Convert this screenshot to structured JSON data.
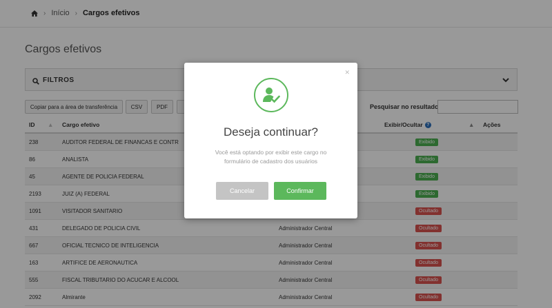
{
  "breadcrumb": {
    "home_icon": "home-icon",
    "items": [
      "Início",
      "Cargos efetivos"
    ]
  },
  "page": {
    "title": "Cargos efetivos"
  },
  "filters": {
    "label": "FILTROS",
    "icon": "search-icon",
    "toggle_icon": "chevron-down-icon"
  },
  "toolbar": {
    "copy_label": "Copiar para a área de transferência",
    "csv_label": "CSV",
    "pdf_label": "PDF",
    "search_label": "Pesquisar no resultado",
    "search_value": ""
  },
  "table": {
    "headers": {
      "id": "ID",
      "cargo": "Cargo efetivo",
      "exibir": "Exibir/Ocultar",
      "acoes": "Ações"
    },
    "rows": [
      {
        "id": "238",
        "cargo": "AUDITOR FEDERAL DE FINANCAS E CONTR",
        "admin": "",
        "status": "Exibido"
      },
      {
        "id": "86",
        "cargo": "ANALISTA",
        "admin": "",
        "status": "Exibido"
      },
      {
        "id": "45",
        "cargo": "AGENTE DE POLICIA FEDERAL",
        "admin": "",
        "status": "Exibido"
      },
      {
        "id": "2193",
        "cargo": "JUIZ (A) FEDERAL",
        "admin": "",
        "status": "Exibido"
      },
      {
        "id": "1091",
        "cargo": "VISITADOR SANITARIO",
        "admin": "",
        "status": "Ocultado"
      },
      {
        "id": "431",
        "cargo": "DELEGADO DE POLICIA CIVIL",
        "admin": "Administrador Central",
        "status": "Ocultado"
      },
      {
        "id": "667",
        "cargo": "OFICIAL TECNICO DE INTELIGENCIA",
        "admin": "Administrador Central",
        "status": "Ocultado"
      },
      {
        "id": "163",
        "cargo": "ARTIFICE DE AERONAUTICA",
        "admin": "Administrador Central",
        "status": "Ocultado"
      },
      {
        "id": "555",
        "cargo": "FISCAL TRIBUTARIO DO ACUCAR E ALCOOL",
        "admin": "Administrador Central",
        "status": "Ocultado"
      },
      {
        "id": "2092",
        "cargo": "Almirante",
        "admin": "Administrador Central",
        "status": "Ocultado"
      }
    ]
  },
  "modal": {
    "icon": "user-check-icon",
    "close_icon": "close-icon",
    "title": "Deseja continuar?",
    "text": "Você está optando por exibir este cargo no formulário de cadastro dos usuários",
    "cancel_label": "Cancelar",
    "confirm_label": "Confirmar"
  },
  "colors": {
    "accent": "#5cb85c",
    "shown": "#4caf50",
    "hidden": "#d9534f",
    "cancel": "#c4c4c4"
  }
}
